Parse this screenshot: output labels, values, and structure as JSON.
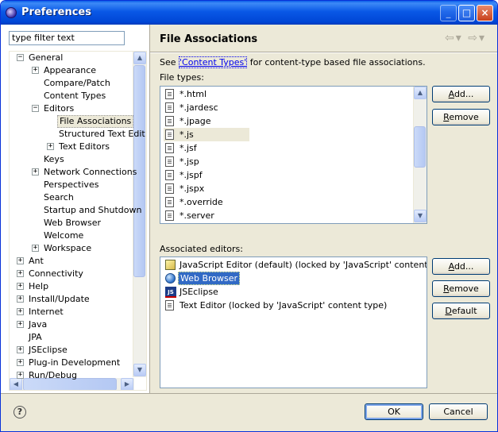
{
  "window": {
    "title": "Preferences",
    "controls": [
      "_",
      "□",
      "×"
    ]
  },
  "filter": {
    "value": "type filter text"
  },
  "tree": {
    "items": [
      {
        "label": "General",
        "level": 0,
        "expander": "−"
      },
      {
        "label": "Appearance",
        "level": 1,
        "expander": "+"
      },
      {
        "label": "Compare/Patch",
        "level": 1,
        "expander": ""
      },
      {
        "label": "Content Types",
        "level": 1,
        "expander": ""
      },
      {
        "label": "Editors",
        "level": 1,
        "expander": "−"
      },
      {
        "label": "File Associations",
        "level": 2,
        "expander": "",
        "selected": true
      },
      {
        "label": "Structured Text Edit",
        "level": 2,
        "expander": ""
      },
      {
        "label": "Text Editors",
        "level": 2,
        "expander": "+"
      },
      {
        "label": "Keys",
        "level": 1,
        "expander": ""
      },
      {
        "label": "Network Connections",
        "level": 1,
        "expander": "+"
      },
      {
        "label": "Perspectives",
        "level": 1,
        "expander": ""
      },
      {
        "label": "Search",
        "level": 1,
        "expander": ""
      },
      {
        "label": "Startup and Shutdown",
        "level": 1,
        "expander": ""
      },
      {
        "label": "Web Browser",
        "level": 1,
        "expander": ""
      },
      {
        "label": "Welcome",
        "level": 1,
        "expander": ""
      },
      {
        "label": "Workspace",
        "level": 1,
        "expander": "+"
      },
      {
        "label": "Ant",
        "level": 0,
        "expander": "+"
      },
      {
        "label": "Connectivity",
        "level": 0,
        "expander": "+"
      },
      {
        "label": "Help",
        "level": 0,
        "expander": "+"
      },
      {
        "label": "Install/Update",
        "level": 0,
        "expander": "+"
      },
      {
        "label": "Internet",
        "level": 0,
        "expander": "+"
      },
      {
        "label": "Java",
        "level": 0,
        "expander": "+"
      },
      {
        "label": "JPA",
        "level": 0,
        "expander": ""
      },
      {
        "label": "JSEclipse",
        "level": 0,
        "expander": "+"
      },
      {
        "label": "Plug-in Development",
        "level": 0,
        "expander": "+"
      },
      {
        "label": "Run/Debug",
        "level": 0,
        "expander": "+"
      }
    ]
  },
  "page": {
    "title": "File Associations",
    "see_prefix": "See ",
    "see_link": "'Content Types'",
    "see_suffix": " for content-type based file associations.",
    "file_types_label": "File types:",
    "associated_label": "Associated editors:",
    "file_types": [
      "*.html",
      "*.jardesc",
      "*.jpage",
      "*.js",
      "*.jsf",
      "*.jsp",
      "*.jspf",
      "*.jspx",
      "*.override",
      "*.server"
    ],
    "selected_file_type": "*.js",
    "editors": [
      {
        "label": "JavaScript Editor (default) (locked by 'JavaScript' content type)",
        "icon": "js-editor-icon"
      },
      {
        "label": "Web Browser",
        "icon": "globe-icon",
        "highlighted": true
      },
      {
        "label": "JSEclipse",
        "icon": "jseclipse-icon"
      },
      {
        "label": "Text Editor (locked by 'JavaScript' content type)",
        "icon": "file-icon"
      }
    ],
    "buttons": {
      "add1": "Add...",
      "remove1": "Remove",
      "add2": "Add...",
      "remove2": "Remove",
      "default": "Default"
    }
  },
  "footer": {
    "help": "?",
    "ok": "OK",
    "cancel": "Cancel"
  }
}
